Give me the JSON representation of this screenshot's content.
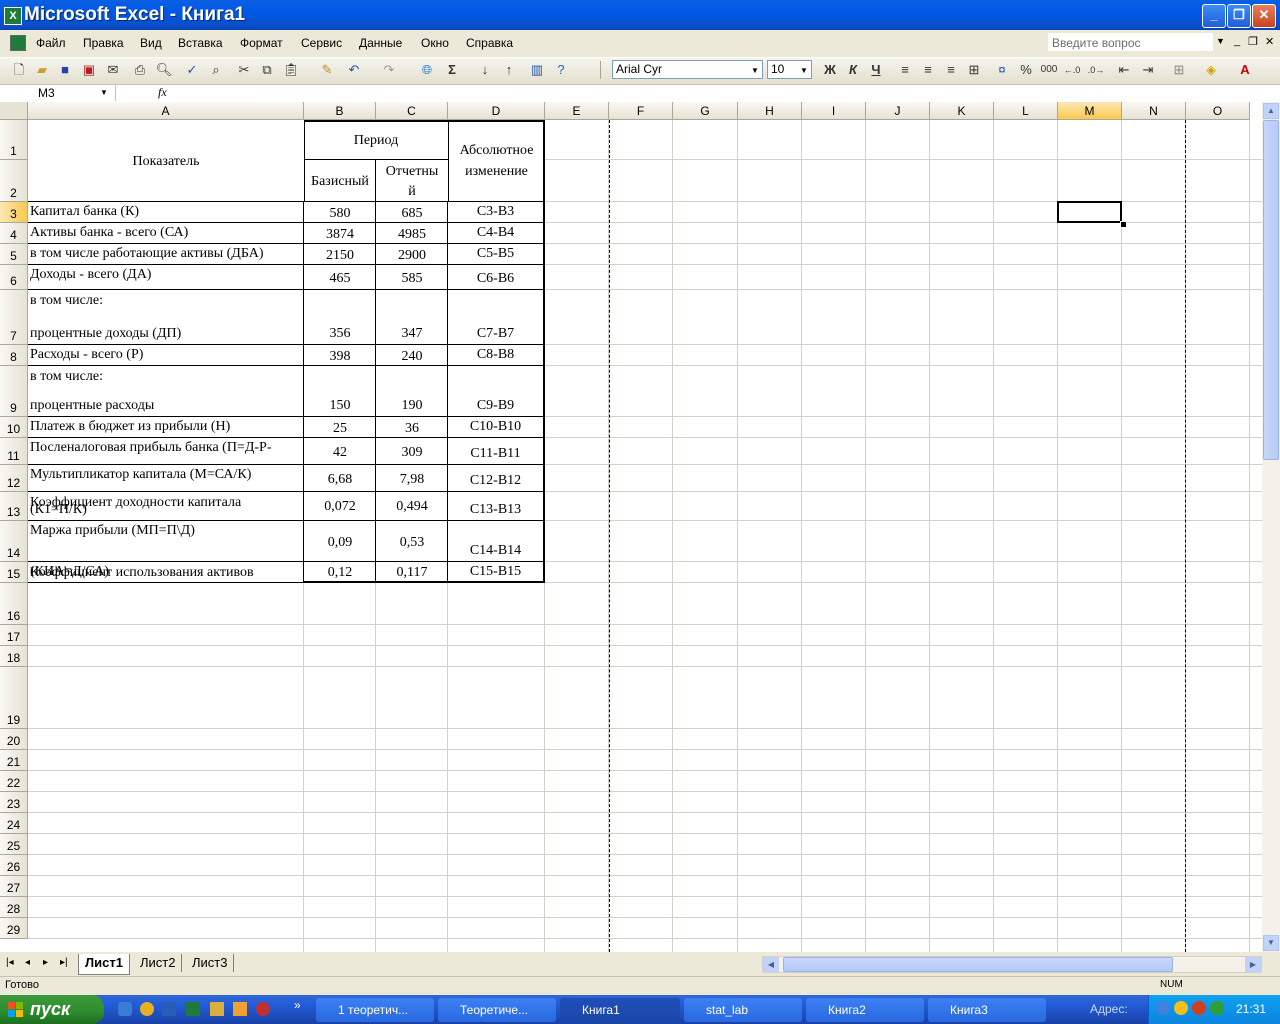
{
  "window": {
    "title": "Microsoft Excel - Книга1",
    "app_icon": "X",
    "controls": [
      "minimize-icon",
      "restore-icon",
      "close-icon"
    ]
  },
  "menubar": {
    "items": [
      "Файл",
      "Правка",
      "Вид",
      "Вставка",
      "Формат",
      "Сервис",
      "Данные",
      "Окно",
      "Справка"
    ],
    "ask_placeholder": "Введите вопрос"
  },
  "toolbar": {
    "font_name": "Arial Cyr",
    "font_size": "10",
    "bold": "Ж",
    "italic": "К",
    "underline": "Ч",
    "percent": "%",
    "thousands": "000",
    "sigma": "Σ"
  },
  "formula_bar": {
    "name_box": "M3",
    "fx_label": "fx",
    "formula": ""
  },
  "grid": {
    "columns": [
      "A",
      "B",
      "C",
      "D",
      "E",
      "F",
      "G",
      "H",
      "I",
      "J",
      "K",
      "L",
      "M",
      "N",
      "O"
    ],
    "selected_column": "M",
    "rows": [
      "1",
      "2",
      "3",
      "4",
      "5",
      "6",
      "7",
      "8",
      "9",
      "10",
      "11",
      "12",
      "13",
      "14",
      "15",
      "16",
      "17",
      "18",
      "19",
      "20",
      "21",
      "22",
      "23",
      "24",
      "25",
      "26",
      "27",
      "28",
      "29"
    ],
    "selected_row": "3",
    "table": {
      "header_indicator": "Показатель",
      "header_period": "Период",
      "header_base": "Базисный",
      "header_report_1": "Отчетны",
      "header_report_2": "й",
      "header_abs_1": "Абсолютное",
      "header_abs_2": "изменение",
      "rows": [
        {
          "label": "Капитал банка (К)",
          "label2": "",
          "b": "580",
          "c": "685",
          "d": "C3-B3"
        },
        {
          "label": "Активы банка - всего (СА)",
          "label2": "",
          "b": "3874",
          "c": "4985",
          "d": "C4-B4"
        },
        {
          "label": "в том числе работающие активы (ДБА)",
          "label2": "",
          "b": "2150",
          "c": "2900",
          "d": "C5-B5"
        },
        {
          "label": "Доходы - всего (ДА)",
          "label2": "",
          "b": "465",
          "c": "585",
          "d": "C6-B6"
        },
        {
          "label": "в том числе:",
          "label2": "процентные доходы (ДП)",
          "b": "356",
          "c": "347",
          "d": "C7-B7"
        },
        {
          "label": "Расходы - всего (Р)",
          "label2": "",
          "b": "398",
          "c": "240",
          "d": "C8-B8"
        },
        {
          "label": "в том числе:",
          "label2": "процентные расходы",
          "b": "150",
          "c": "190",
          "d": "C9-B9"
        },
        {
          "label": "Платеж в бюджет из прибыли (Н)",
          "label2": "",
          "b": "25",
          "c": "36",
          "d": "C10-B10"
        },
        {
          "label": "Посленалоговая прибыль банка (П=Д-Р-",
          "label2": "",
          "b": "42",
          "c": "309",
          "d": "C11-B11"
        },
        {
          "label": "Мультипликатор капитала (М=СА/К)",
          "label2": "",
          "b": "6,68",
          "c": "7,98",
          "d": "C12-B12"
        },
        {
          "label": "Коэффициент доходности капитала",
          "label2": "(К1=П/К)",
          "b": "0,072",
          "c": "0,494",
          "d": "C13-B13"
        },
        {
          "label": "Маржа прибыли (МП=П\\Д)",
          "label2": "",
          "b": "0,09",
          "c": "0,53",
          "d": "C14-B14"
        },
        {
          "label": "Коэффициент использования активов",
          "label2": "(КИА=Д/СА)",
          "b": "0,12",
          "c": "0,117",
          "d": "C15-B15"
        }
      ]
    }
  },
  "sheets": {
    "tabs": [
      "Лист1",
      "Лист2",
      "Лист3"
    ],
    "active": "Лист1"
  },
  "status": {
    "ready": "Готово",
    "num": "NUM"
  },
  "taskbar": {
    "start": "пуск",
    "items": [
      "1 теоретич...",
      "Теоретиче...",
      "Книга1",
      "stat_lab",
      "Книга2",
      "Книга3"
    ],
    "active_item": "Книга1",
    "address_label": "Адрес:",
    "clock": "21:31"
  }
}
